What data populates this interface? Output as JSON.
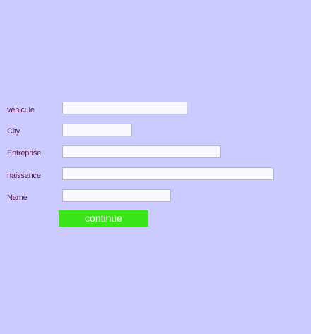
{
  "form": {
    "fields": [
      {
        "label": "vehicule",
        "value": "",
        "placeholder": ""
      },
      {
        "label": "City",
        "value": "",
        "placeholder": ""
      },
      {
        "label": "Entreprise",
        "value": "",
        "placeholder": ""
      },
      {
        "label": "naissance",
        "value": "",
        "placeholder": ""
      },
      {
        "label": "Name",
        "value": "",
        "placeholder": ""
      }
    ],
    "submit_label": "continue"
  },
  "colors": {
    "background": "#cbcbff",
    "label_text": "#5a1a4a",
    "button_background": "#3ae61a",
    "button_text": "#ffffff",
    "input_background": "#f9f8ff"
  }
}
